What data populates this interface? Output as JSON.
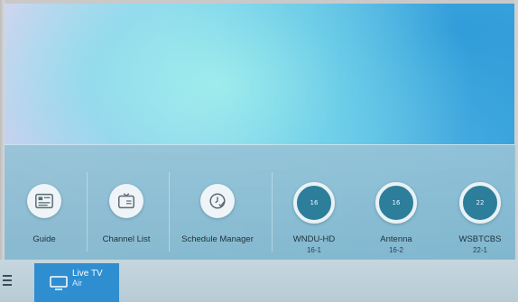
{
  "menu": {
    "items": [
      {
        "label": "Guide",
        "icon": "guide-icon"
      },
      {
        "label": "Channel List",
        "icon": "channel-list-icon"
      },
      {
        "label": "Schedule Manager",
        "icon": "clock-icon"
      }
    ],
    "channels": [
      {
        "number": "16",
        "name": "WNDU-HD",
        "sub": "16-1"
      },
      {
        "number": "16",
        "name": "Antenna",
        "sub": "16-2"
      },
      {
        "number": "22",
        "name": "WSBTCBS",
        "sub": "22-1"
      }
    ]
  },
  "bottom_bar": {
    "menu_icon": "hamburger-icon",
    "live_tv": {
      "title": "Live TV",
      "subtitle": "Air",
      "icon": "tv-icon"
    }
  },
  "colors": {
    "channel_circle": "#2d7e9a",
    "live_tv_tile": "#2f8ed0",
    "menu_panel": "#8fbdd3"
  }
}
